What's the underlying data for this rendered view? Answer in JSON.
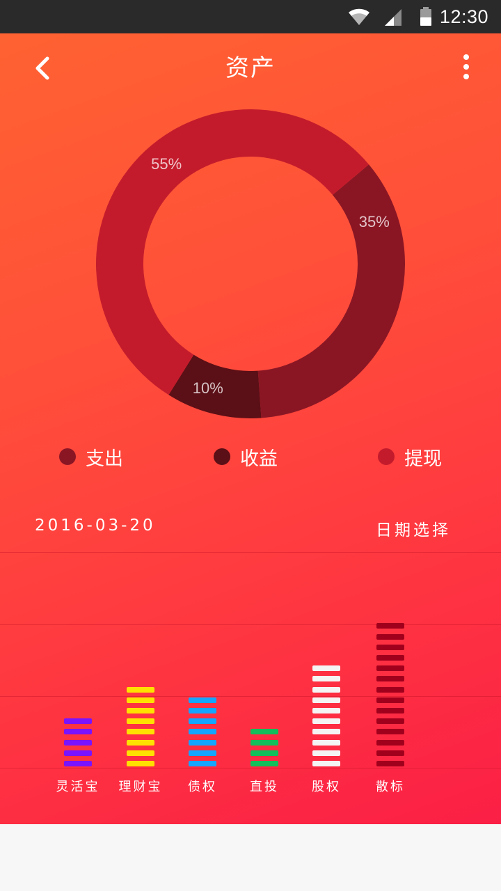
{
  "status_bar": {
    "time": "12:30",
    "icons": [
      "wifi-icon",
      "cell-signal-icon",
      "battery-icon"
    ]
  },
  "header": {
    "title": "资产",
    "back_icon": "chevron-left-icon",
    "menu_icon": "more-vertical-icon"
  },
  "chart_data": [
    {
      "type": "pie",
      "donut": true,
      "slices": [
        {
          "name": "收益",
          "value": 35,
          "label": "35%",
          "color": "#8a1624"
        },
        {
          "name": "支出",
          "value": 10,
          "label": "10%",
          "color": "#5b0f16"
        },
        {
          "name": "提现",
          "value": 55,
          "label": "55%",
          "color": "#c41b2c"
        }
      ],
      "legend": [
        {
          "label": "支出",
          "color": "#8a1624"
        },
        {
          "label": "收益",
          "color": "#5b0f16"
        },
        {
          "label": "提现",
          "color": "#c41b2c"
        }
      ],
      "legend_position": "bottom"
    },
    {
      "type": "bar",
      "style": "segmented",
      "categories": [
        "灵活宝",
        "理财宝",
        "债权",
        "直投",
        "股权",
        "散标"
      ],
      "values": [
        5,
        8,
        7,
        4,
        10,
        14
      ],
      "colors": [
        "#7a13ff",
        "#ffe100",
        "#14a5ff",
        "#12bf5a",
        "#f4f4f4",
        "#a1001c"
      ],
      "grid": true
    }
  ],
  "date": {
    "value": "2016-03-20",
    "picker_label": "日期选择"
  }
}
